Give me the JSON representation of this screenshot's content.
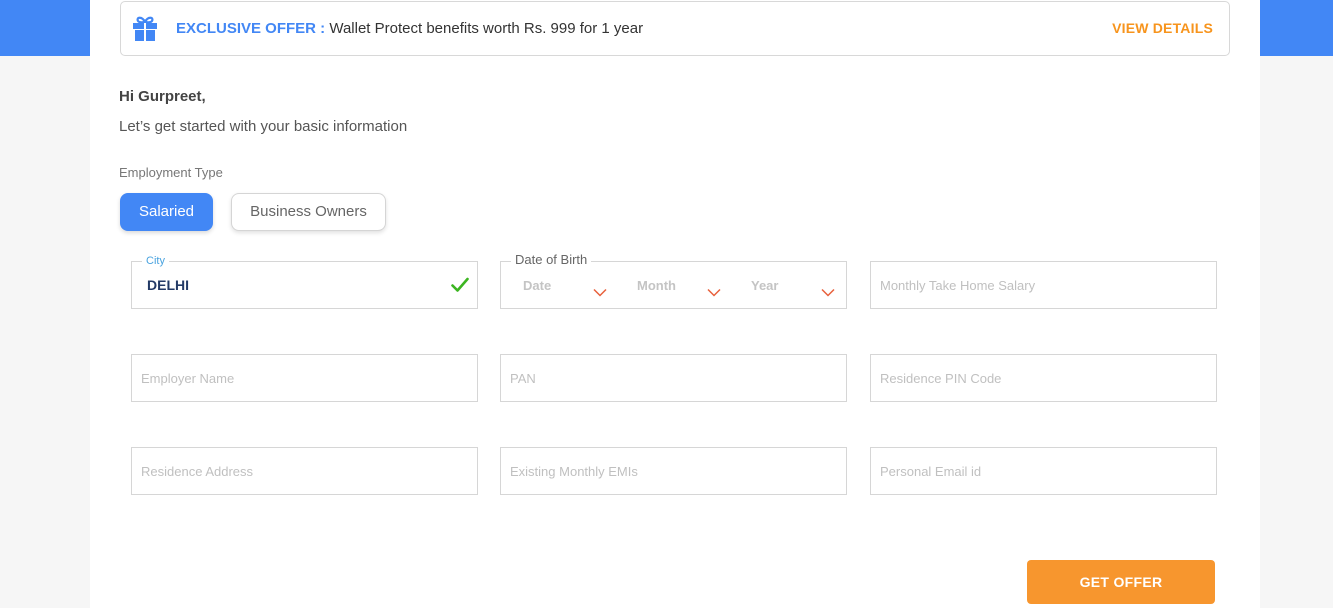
{
  "offer_banner": {
    "icon": "gift-icon",
    "label": "EXCLUSIVE OFFER :",
    "text": " Wallet Protect benefits worth Rs. 999 for 1 year",
    "link": "VIEW DETAILS"
  },
  "greeting": "Hi Gurpreet,",
  "subtitle": "Let’s get started with your basic information",
  "employment_type": {
    "label": "Employment Type",
    "options": [
      {
        "label": "Salaried",
        "selected": true
      },
      {
        "label": "Business Owners",
        "selected": false
      }
    ]
  },
  "form": {
    "city": {
      "label": "City",
      "value": "DELHI",
      "status_icon": "check-icon"
    },
    "dob": {
      "label": "Date of Birth",
      "date": "Date",
      "month": "Month",
      "year": "Year",
      "icon": "chevron-down-icon"
    },
    "salary": {
      "placeholder": "Monthly Take Home Salary"
    },
    "employer": {
      "placeholder": "Employer Name"
    },
    "pan": {
      "placeholder": "PAN"
    },
    "pin": {
      "placeholder": "Residence PIN Code"
    },
    "address": {
      "placeholder": "Residence Address"
    },
    "emis": {
      "placeholder": "Existing Monthly EMIs"
    },
    "email": {
      "placeholder": "Personal Email id"
    }
  },
  "submit_label": "GET OFFER",
  "colors": {
    "primary": "#4287f5",
    "accent": "#f7962e",
    "success": "#3cb521",
    "chevron": "#e8603c"
  }
}
